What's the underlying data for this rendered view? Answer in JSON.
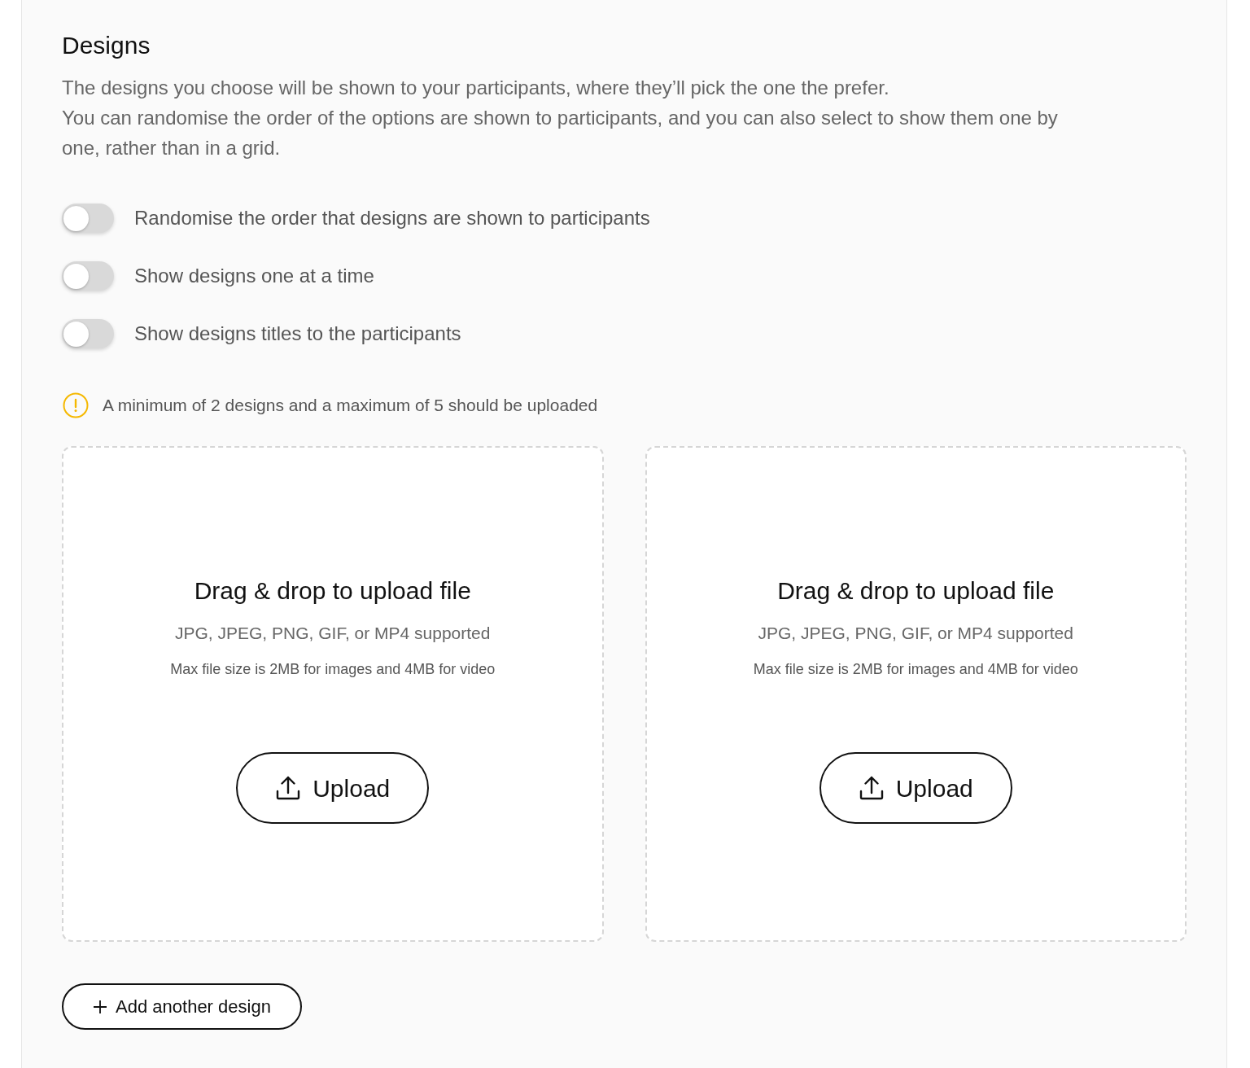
{
  "section": {
    "title": "Designs",
    "description": [
      "The designs you choose will be shown to your participants, where they’ll pick the one the prefer.",
      "You can randomise the order of the options are shown to participants, and you can also select to show them one by one, rather than in a grid."
    ]
  },
  "toggles": [
    {
      "label": "Randomise the order that designs are shown to participants",
      "on": false
    },
    {
      "label": "Show designs one at a time",
      "on": false
    },
    {
      "label": "Show designs titles to the participants",
      "on": false
    }
  ],
  "notice": {
    "text": "A minimum of 2 designs and a maximum of 5 should be uploaded"
  },
  "dropzones": [
    {
      "title": "Drag & drop to upload file",
      "formats": "JPG, JPEG, PNG, GIF, or MP4 supported",
      "size_limit": "Max file size is 2MB for images and 4MB for video",
      "button": "Upload"
    },
    {
      "title": "Drag & drop to upload file",
      "formats": "JPG, JPEG, PNG, GIF, or MP4 supported",
      "size_limit": "Max file size is 2MB for images and 4MB for video",
      "button": "Upload"
    }
  ],
  "add_button": {
    "label": "Add another design"
  }
}
